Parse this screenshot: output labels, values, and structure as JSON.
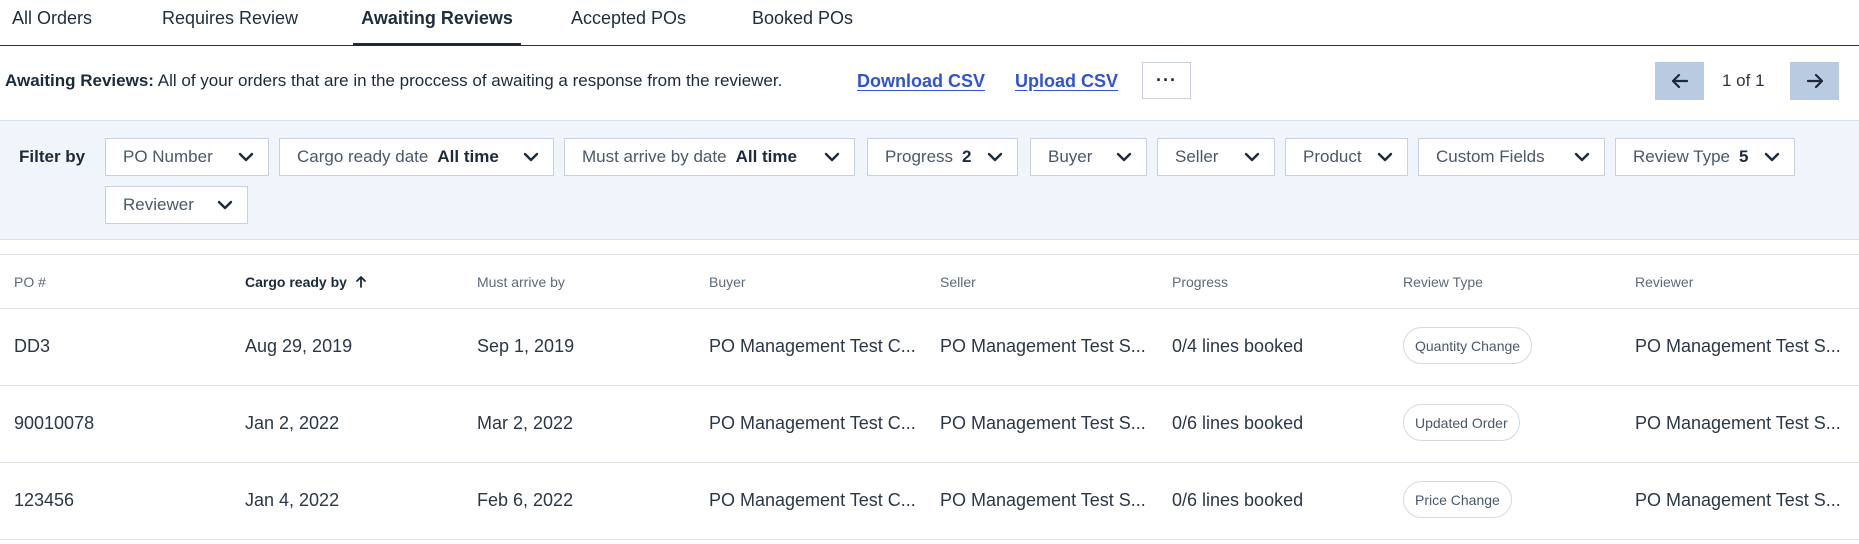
{
  "tabs": [
    {
      "label": "All Orders",
      "active": false
    },
    {
      "label": "Requires Review",
      "active": false
    },
    {
      "label": "Awaiting Reviews",
      "active": true
    },
    {
      "label": "Accepted POs",
      "active": false
    },
    {
      "label": "Booked POs",
      "active": false
    }
  ],
  "info": {
    "heading": "Awaiting Reviews:",
    "description": "All of your orders that are in the proccess of awaiting a response from the reviewer.",
    "download_label": "Download CSV",
    "upload_label": "Upload CSV",
    "more_label": "···"
  },
  "pager": {
    "text": "1 of 1"
  },
  "filters": {
    "label": "Filter by",
    "items": [
      {
        "label": "PO Number",
        "value": ""
      },
      {
        "label": "Cargo ready date",
        "value": "All time"
      },
      {
        "label": "Must arrive by date",
        "value": "All time"
      },
      {
        "label": "Progress",
        "value": "2"
      },
      {
        "label": "Buyer",
        "value": ""
      },
      {
        "label": "Seller",
        "value": ""
      },
      {
        "label": "Product",
        "value": ""
      },
      {
        "label": "Custom Fields",
        "value": ""
      },
      {
        "label": "Review Type",
        "value": "5"
      },
      {
        "label": "Reviewer",
        "value": ""
      }
    ]
  },
  "table": {
    "columns": [
      "PO #",
      "Cargo ready by",
      "Must arrive by",
      "Buyer",
      "Seller",
      "Progress",
      "Review Type",
      "Reviewer"
    ],
    "sorted_column": "Cargo ready by",
    "rows": [
      {
        "po": "DD3",
        "cargo_ready": "Aug 29, 2019",
        "must_arrive": "Sep 1, 2019",
        "buyer": "PO Management Test C...",
        "seller": "PO Management Test S...",
        "progress": "0/4 lines booked",
        "review_type": "Quantity Change",
        "reviewer": "PO Management Test S..."
      },
      {
        "po": "90010078",
        "cargo_ready": "Jan 2, 2022",
        "must_arrive": "Mar 2, 2022",
        "buyer": "PO Management Test C...",
        "seller": "PO Management Test S...",
        "progress": "0/6 lines booked",
        "review_type": "Updated Order",
        "reviewer": "PO Management Test S..."
      },
      {
        "po": "123456",
        "cargo_ready": "Jan 4, 2022",
        "must_arrive": "Feb 6, 2022",
        "buyer": "PO Management Test C...",
        "seller": "PO Management Test S...",
        "progress": "0/6 lines booked",
        "review_type": "Price Change",
        "reviewer": "PO Management Test S..."
      }
    ]
  },
  "colors": {
    "link": "#2f53d2",
    "pager_button": "#b9cbe0",
    "filter_panel": "#f0f5fc"
  }
}
